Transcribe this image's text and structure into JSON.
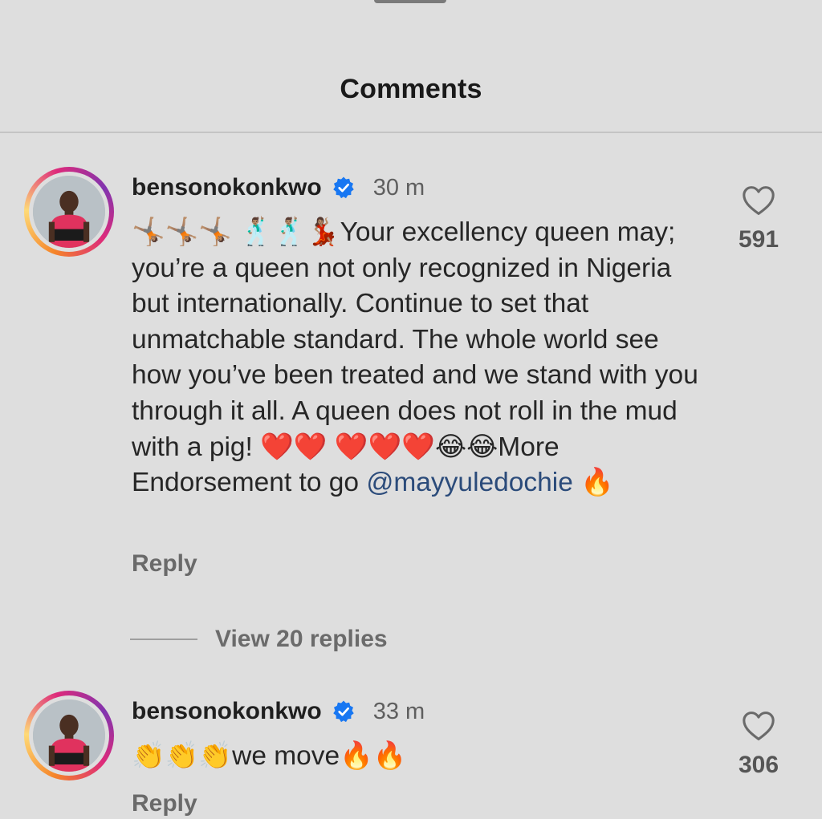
{
  "sheet": {
    "title": "Comments"
  },
  "comments": [
    {
      "username": "bensonokonkwo",
      "verified": true,
      "time": "30 m",
      "text": "🤸🏽🤸🏽🤸🏽 🕺🏽🕺🏽💃🏽Your excellency queen may; you’re a queen not only recognized in Nigeria but internationally. Continue to set that unmatchable standard. The whole world see how you’ve been treated and we stand with you through it all. A queen does not roll in the mud with a pig! ❤️❤️ ❤️❤️❤️😂😂More Endorsement to go",
      "mention": "@mayyuledochie",
      "mention_suffix": " 🔥",
      "reply_label": "Reply",
      "likes": "591",
      "view_replies": "View 20 replies"
    },
    {
      "username": "bensonokonkwo",
      "verified": true,
      "time": "33 m",
      "text": "👏👏👏we move🔥🔥",
      "reply_label": "Reply",
      "likes": "306"
    }
  ],
  "icons": {
    "like": "heart-outline-icon",
    "verified": "verified-badge-icon"
  },
  "colors": {
    "background": "#dedede",
    "verified_blue": "#1877f2",
    "mention": "#2b4b7a"
  }
}
